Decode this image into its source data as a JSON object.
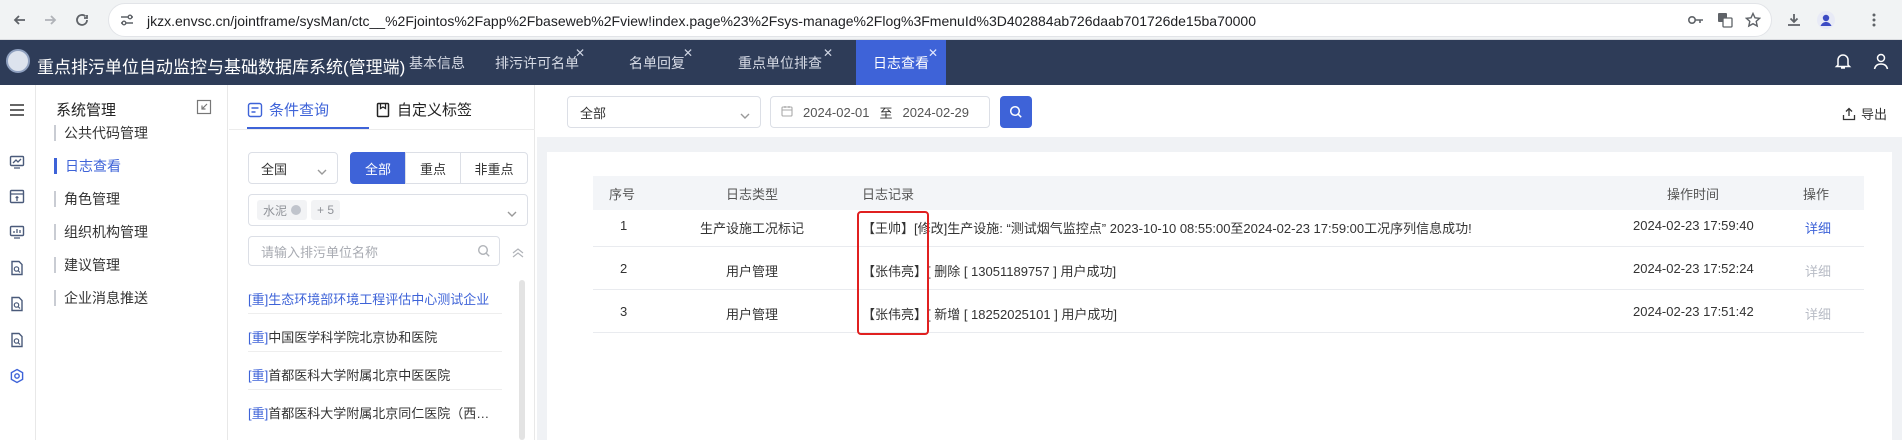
{
  "browser": {
    "url": "jkzx.envsc.cn/jointframe/sysMan/ctc__%2Fjointos%2Fapp%2Fbaseweb%2Fview!index.page%23%2Fsys-manage%2Flog%3FmenuId%3D402884ab726daab701726de15ba70000"
  },
  "app": {
    "title": "重点排污单位自动监控与基础数据库系统(管理端)",
    "tabs": [
      {
        "label": "基本信息",
        "closable": false,
        "active": false
      },
      {
        "label": "排污许可名单",
        "closable": true,
        "active": false
      },
      {
        "label": "名单回复",
        "closable": true,
        "active": false
      },
      {
        "label": "重点单位排查",
        "closable": true,
        "active": false
      },
      {
        "label": "日志查看",
        "closable": true,
        "active": true
      }
    ],
    "accent_color": "#3e63d8",
    "header_color": "#2e3c58"
  },
  "sysmenu": {
    "title": "系统管理",
    "items": [
      {
        "label": "公共代码管理",
        "active": false
      },
      {
        "label": "日志查看",
        "active": true
      },
      {
        "label": "角色管理",
        "active": false
      },
      {
        "label": "组织机构管理",
        "active": false
      },
      {
        "label": "建议管理",
        "active": false
      },
      {
        "label": "企业消息推送",
        "active": false
      }
    ]
  },
  "filter": {
    "tab_query": "条件查询",
    "tab_custom": "自定义标签",
    "region": "全国",
    "segments": [
      "全部",
      "重点",
      "非重点"
    ],
    "tag": "水泥",
    "tag_more": "+ 5",
    "search_placeholder": "请输入排污单位名称",
    "orgs": [
      {
        "prefix": "[重]",
        "name": "生态环境部环境工程评估中心测试企业",
        "selected": true
      },
      {
        "prefix": "[重]",
        "name": "中国医学科学院北京协和医院",
        "selected": false
      },
      {
        "prefix": "[重]",
        "name": "首都医科大学附属北京中医医院",
        "selected": false
      },
      {
        "prefix": "[重]",
        "name": "首都医科大学附属北京同仁医院（西…",
        "selected": false
      }
    ]
  },
  "toolbar": {
    "type_select": "全部",
    "date_from": "2024-02-01",
    "date_sep": "至",
    "date_to": "2024-02-29",
    "export_label": "导出"
  },
  "table": {
    "headers": [
      "序号",
      "日志类型",
      "日志记录",
      "操作时间",
      "操作"
    ],
    "rows": [
      {
        "no": "1",
        "type": "生产设施工况标记",
        "record": "【王帅】[修改]生产设施: “测试烟气监控点” 2023-10-10 08:55:00至2024-02-23 17:59:00工况序列信息成功!",
        "time": "2024-02-23 17:59:40",
        "action": "详细",
        "enabled": true
      },
      {
        "no": "2",
        "type": "用户管理",
        "record": "【张伟亮】[ 删除 [ 13051189757 ] 用户成功]",
        "time": "2024-02-23 17:52:24",
        "action": "详细",
        "enabled": false
      },
      {
        "no": "3",
        "type": "用户管理",
        "record": "【张伟亮】[ 新增 [ 18252025101 ] 用户成功]",
        "time": "2024-02-23 17:51:42",
        "action": "详细",
        "enabled": false
      }
    ]
  }
}
